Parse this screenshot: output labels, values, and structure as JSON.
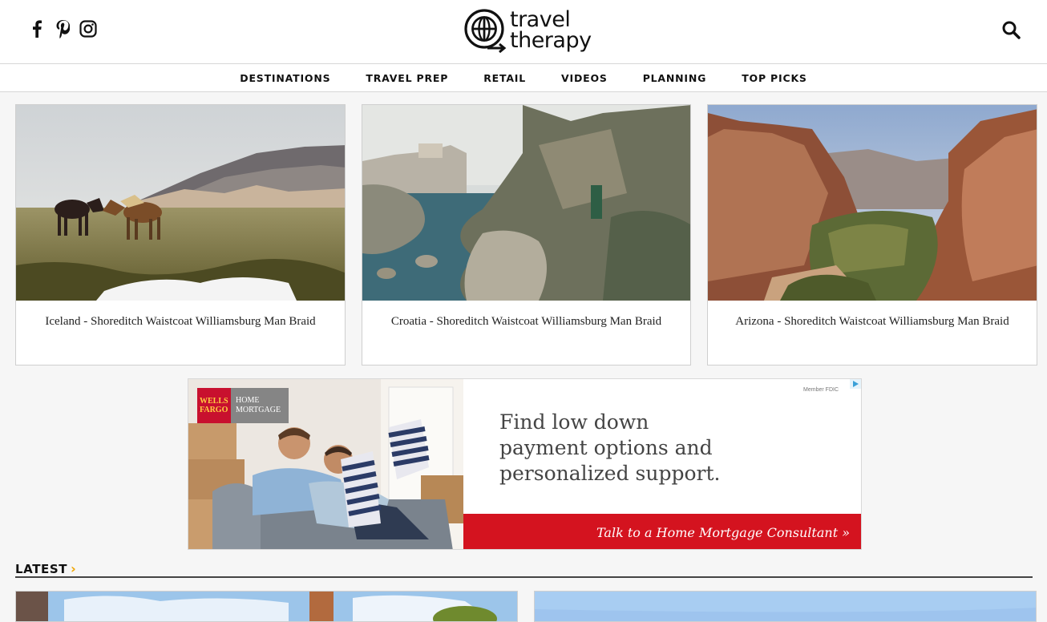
{
  "header": {
    "social_icons": [
      "facebook-icon",
      "pinterest-icon",
      "instagram-icon"
    ],
    "logo": {
      "line1": "travel",
      "line2": "therapy"
    },
    "search_icon": "search-icon"
  },
  "nav": {
    "items": [
      {
        "label": "DESTINATIONS"
      },
      {
        "label": "TRAVEL PREP"
      },
      {
        "label": "RETAIL"
      },
      {
        "label": "VIDEOS"
      },
      {
        "label": "PLANNING"
      },
      {
        "label": "TOP PICKS"
      }
    ]
  },
  "featured": [
    {
      "caption": "Iceland - Shoreditch Waistcoat Williamsburg Man Braid"
    },
    {
      "caption": "Croatia - Shoreditch Waistcoat Williamsburg Man Braid"
    },
    {
      "caption": "Arizona - Shoreditch Waistcoat Williamsburg Man Braid"
    }
  ],
  "ad": {
    "brand_line1": "WELLS",
    "brand_line2": "FARGO",
    "product_line1": "HOME",
    "product_line2": "MORTGAGE",
    "member": "Member FDIC",
    "headline_line1": "Find low down",
    "headline_line2": "payment options and",
    "headline_line3": "personalized support.",
    "cta": "Talk to a Home Mortgage Consultant »"
  },
  "latest": {
    "label": "LATEST",
    "chevron": "›"
  },
  "colors": {
    "accent": "#f0a500",
    "ad_red": "#d4131f",
    "wf_red": "#c8102e",
    "wf_yellow": "#ffcd41"
  }
}
